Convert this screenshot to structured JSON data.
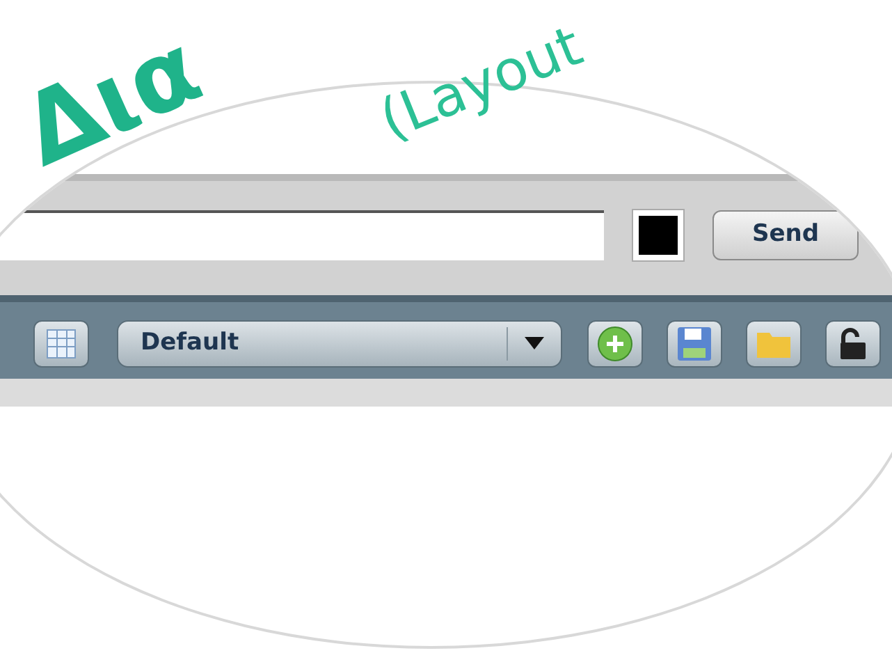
{
  "heading": {
    "title": "Δια",
    "subtitle": "(Layout"
  },
  "compose": {
    "send_button": "Send"
  },
  "toolbar": {
    "layout_select": {
      "value": "Default"
    }
  }
}
